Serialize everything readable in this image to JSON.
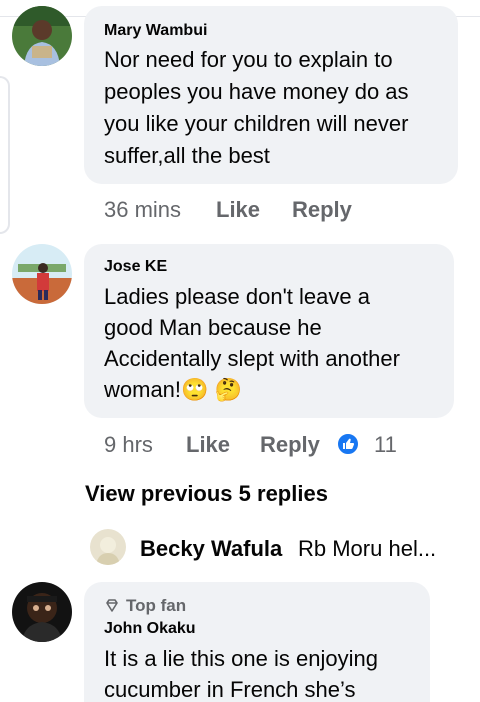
{
  "comments": [
    {
      "author": "Mary Wambui",
      "text_lines": [
        "Nor need for you to explain to",
        "peoples you have money do as",
        "you like your children will never",
        "suffer,all the best"
      ],
      "time": "36 mins",
      "like_label": "Like",
      "reply_label": "Reply"
    },
    {
      "author": "Jose KE",
      "text_lines": [
        "Ladies please don't leave a",
        "good Man because he",
        "Accidentally slept with another",
        "woman!🙄 🤔"
      ],
      "time": "9 hrs",
      "like_label": "Like",
      "reply_label": "Reply",
      "reaction_count": "11"
    },
    {
      "badge": "Top fan",
      "author": "John Okaku",
      "text_lines": [
        "It is a lie this one is enjoying",
        "cucumber in French she’s"
      ]
    }
  ],
  "view_previous": "View previous 5 replies",
  "reply_preview": {
    "author": "Becky Wafula",
    "snippet": "Rb Moru hel..."
  },
  "colors": {
    "bubble": "#f0f2f5",
    "meta": "#65676b",
    "like_blue": "#1877f2"
  },
  "icons": [
    "thumbs-up-icon",
    "diamond-icon"
  ]
}
